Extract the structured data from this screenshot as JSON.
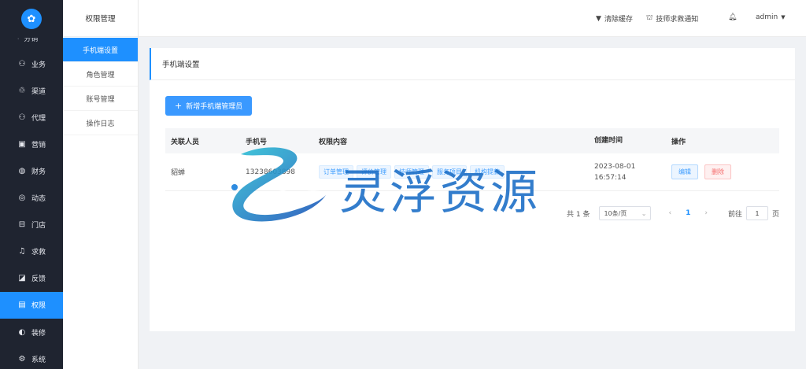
{
  "rail": {
    "partial_label": "分销",
    "items": [
      {
        "label": "业务",
        "icon": "person-icon",
        "glyph": "⚇"
      },
      {
        "label": "渠道",
        "icon": "recycle-icon",
        "glyph": "♲"
      },
      {
        "label": "代理",
        "icon": "person-icon",
        "glyph": "⚇"
      },
      {
        "label": "营销",
        "icon": "image-icon",
        "glyph": "▣"
      },
      {
        "label": "财务",
        "icon": "wallet-icon",
        "glyph": "◍"
      },
      {
        "label": "动态",
        "icon": "compass-icon",
        "glyph": "◎"
      },
      {
        "label": "门店",
        "icon": "store-icon",
        "glyph": "⊟"
      },
      {
        "label": "求救",
        "icon": "bell-icon",
        "glyph": "♫"
      },
      {
        "label": "反馈",
        "icon": "feedback-icon",
        "glyph": "◪"
      },
      {
        "label": "权限",
        "icon": "permission-icon",
        "glyph": "▤"
      },
      {
        "label": "装修",
        "icon": "palette-icon",
        "glyph": "◐"
      },
      {
        "label": "系统",
        "icon": "gear-icon",
        "glyph": "⚙"
      }
    ],
    "active_index": 9
  },
  "subnav": {
    "title": "权限管理",
    "items": [
      "手机端设置",
      "角色管理",
      "账号管理",
      "操作日志"
    ],
    "active_index": 0
  },
  "topbar": {
    "clear_cache": "清除缓存",
    "sos_notice": "技师求救通知",
    "user": "admin"
  },
  "card": {
    "title": "手机端设置",
    "add_button": "新增手机端管理员"
  },
  "table": {
    "headers": [
      "关联人员",
      "手机号",
      "权限内容",
      "创建时间",
      "操作"
    ],
    "rows": [
      {
        "person": "貂蝉",
        "phone": "13238603898",
        "tags": [
          "订单管理",
          "评价管理",
          "技师管理",
          "服务项目",
          "机构提款"
        ],
        "date": "2023-08-01",
        "time": "16:57:14",
        "edit": "编辑",
        "delete": "删除"
      }
    ]
  },
  "pager": {
    "total": "共 1 条",
    "page_size": "10条/页",
    "current": "1",
    "goto_label": "前往",
    "goto_value": "1",
    "page_unit": "页"
  },
  "watermark": {
    "text": "灵浮资源"
  },
  "colors": {
    "accent": "#1e90ff",
    "sidebar_bg": "#1f2430"
  }
}
